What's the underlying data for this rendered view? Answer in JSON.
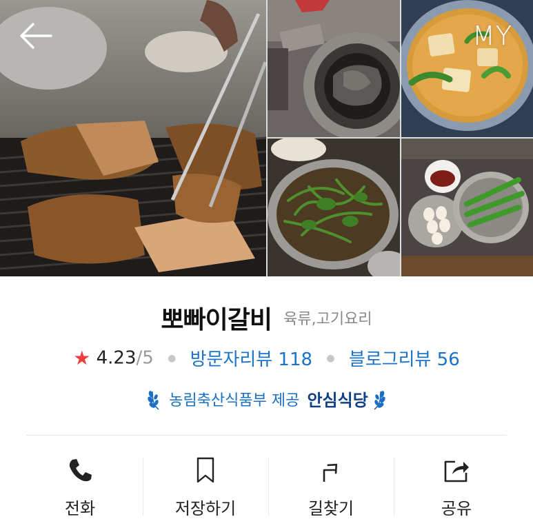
{
  "header": {
    "my_label": "MY"
  },
  "restaurant": {
    "name": "뽀빠이갈비",
    "category": "육류,고기요리",
    "rating": "4.23",
    "rating_max": "/5",
    "visitor_review_label": "방문자리뷰 118",
    "blog_review_label": "블로그리뷰 56"
  },
  "badge": {
    "provider": "농림축산식품부 제공",
    "title": "안심식당"
  },
  "actions": [
    {
      "label": "전화",
      "icon": "phone-icon"
    },
    {
      "label": "저장하기",
      "icon": "bookmark-icon"
    },
    {
      "label": "길찾기",
      "icon": "directions-icon"
    },
    {
      "label": "공유",
      "icon": "share-icon"
    }
  ],
  "colors": {
    "accent_blue": "#1a73c8",
    "star_red": "#f03c3c",
    "badge_dark": "#0f3f8a"
  }
}
